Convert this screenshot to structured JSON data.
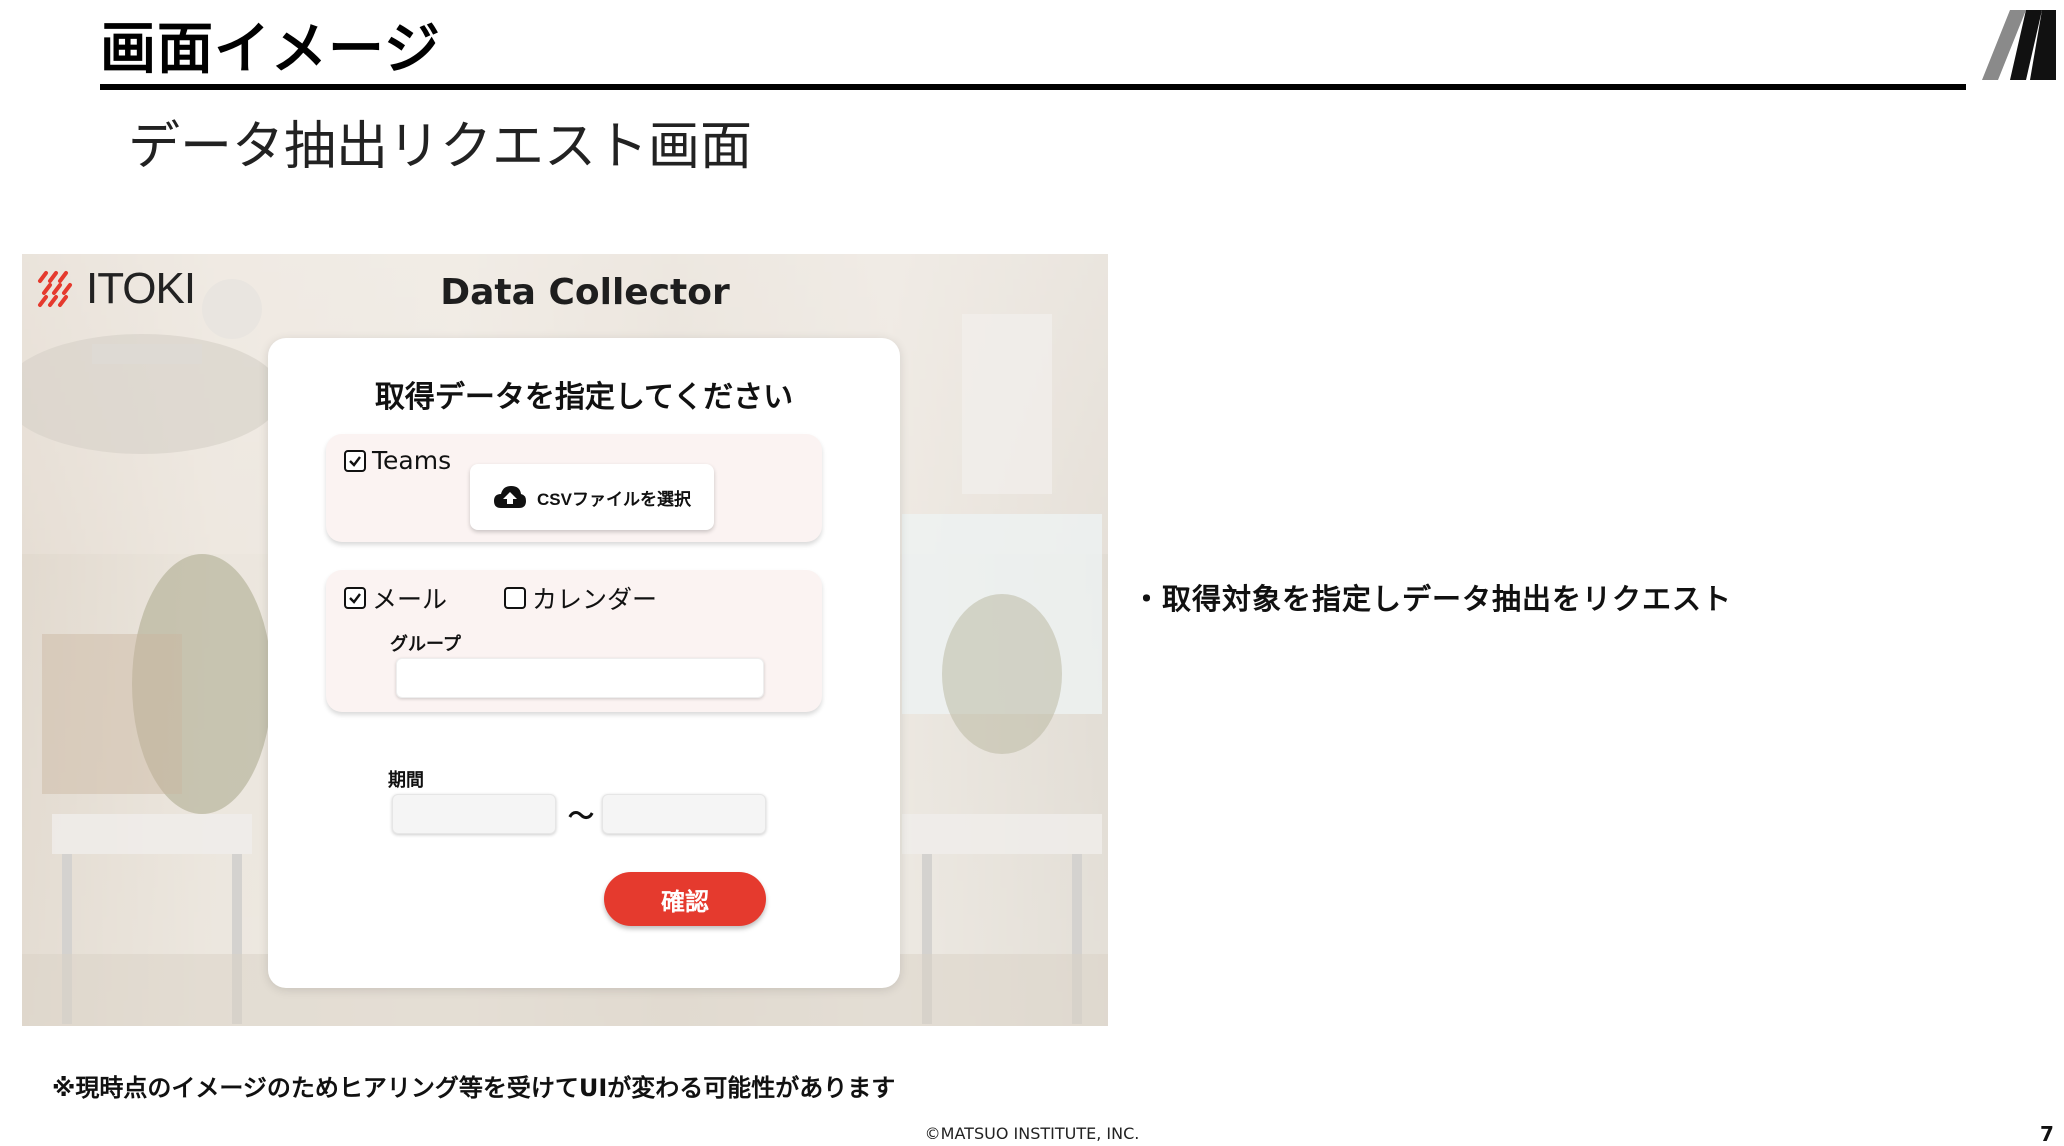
{
  "slide": {
    "title": "画面イメージ",
    "subtitle": "データ抽出リクエスト画面",
    "bullet": "・取得対象を指定しデータ抽出をリクエスト",
    "note": "※現時点のイメージのためヒアリング等を受けてUIが変わる可能性があります",
    "copyright": "©MATSUO INSTITUTE, INC.",
    "page_number": "7"
  },
  "app": {
    "brand": "ITOKI",
    "title": "Data Collector",
    "heading": "取得データを指定してください",
    "teams": {
      "label": "Teams",
      "checked": true
    },
    "upload_button": "CSVファイルを選択",
    "mail": {
      "label": "メール",
      "checked": true
    },
    "calendar": {
      "label": "カレンダー",
      "checked": false
    },
    "group_label": "グループ",
    "group_value": "",
    "period_label": "期間",
    "period_separator": "〜",
    "period_start": "",
    "period_end": "",
    "confirm_button": "確認"
  },
  "colors": {
    "accent": "#e53a2e",
    "panel_bg": "#fbf3f2",
    "brand_mark": "#e53a2e"
  },
  "icons": [
    "m-logo-icon",
    "itoki-mark-icon",
    "checkbox-checked-icon",
    "checkbox-empty-icon",
    "cloud-upload-icon"
  ]
}
